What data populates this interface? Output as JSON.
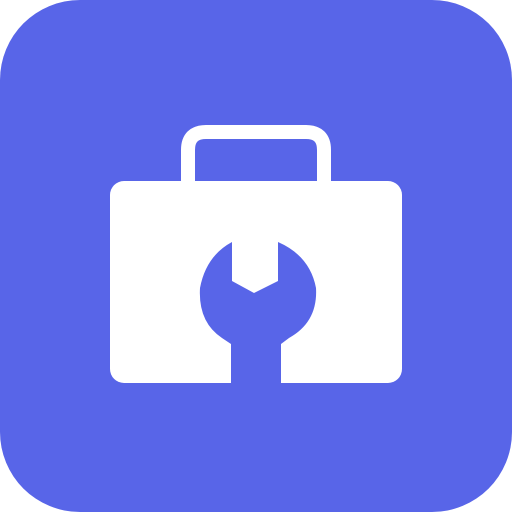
{
  "app_icon": {
    "icon": "toolbox-wrench-icon",
    "colors": {
      "background": "#5865E8",
      "glyph": "#FFFFFF"
    }
  }
}
